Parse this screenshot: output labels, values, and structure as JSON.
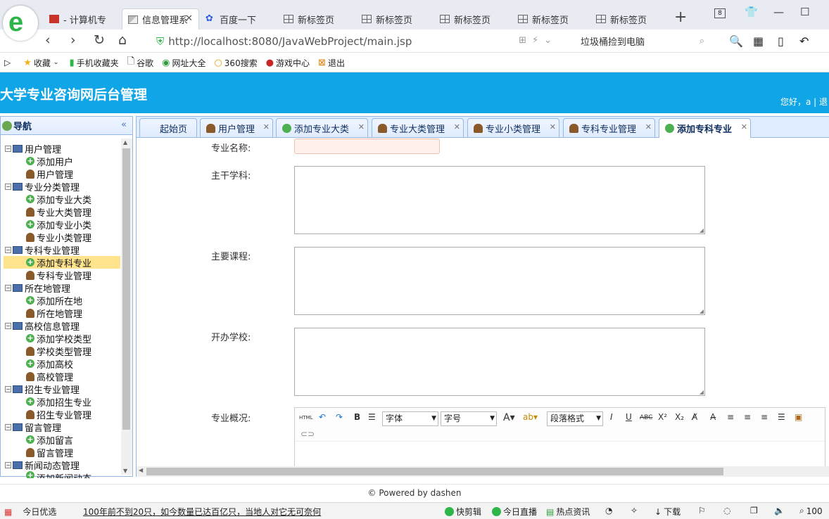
{
  "browser": {
    "tabs": [
      {
        "label": "- 计算机专",
        "icon": "red-square-icon",
        "active": false
      },
      {
        "label": "信息管理系",
        "icon": "image-icon",
        "active": true
      },
      {
        "label": "百度一下",
        "icon": "baidu-paw-icon",
        "active": false
      },
      {
        "label": "新标签页",
        "icon": "grid-icon",
        "active": false
      },
      {
        "label": "新标签页",
        "icon": "grid-icon",
        "active": false
      },
      {
        "label": "新标签页",
        "icon": "grid-icon",
        "active": false
      },
      {
        "label": "新标签页",
        "icon": "grid-icon",
        "active": false
      },
      {
        "label": "新标签页",
        "icon": "grid-icon",
        "active": false
      }
    ],
    "tab_count": "8",
    "url": "http://localhost:8080/JavaWebProject/main.jsp",
    "search_text": "垃圾桶捡到电脑",
    "bookmarks": [
      "收藏",
      "手机收藏夹",
      "谷歌",
      "网址大全",
      "360搜索",
      "游戏中心",
      "退出"
    ]
  },
  "app": {
    "title": "大学专业咨询网后台管理",
    "greeting": "您好，a | 退",
    "nav_title": "导航",
    "tree": [
      {
        "label": "用户管理",
        "children": [
          "添加用户",
          "用户管理"
        ]
      },
      {
        "label": "专业分类管理",
        "children": [
          "添加专业大类",
          "专业大类管理",
          "添加专业小类",
          "专业小类管理"
        ]
      },
      {
        "label": "专科专业管理",
        "children": [
          "添加专科专业",
          "专科专业管理"
        ]
      },
      {
        "label": "所在地管理",
        "children": [
          "添加所在地",
          "所在地管理"
        ]
      },
      {
        "label": "高校信息管理",
        "children": [
          "添加学校类型",
          "学校类型管理",
          "添加高校",
          "高校管理"
        ]
      },
      {
        "label": "招生专业管理",
        "children": [
          "添加招生专业",
          "招生专业管理"
        ]
      },
      {
        "label": "留言管理",
        "children": [
          "添加留言",
          "留言管理"
        ]
      },
      {
        "label": "新闻动态管理",
        "children": [
          "添加新闻动态"
        ]
      }
    ],
    "selected_node": "添加专科专业",
    "tabs": [
      {
        "label": "起始页",
        "icon": "none",
        "closable": false
      },
      {
        "label": "用户管理",
        "icon": "user-icon",
        "closable": true
      },
      {
        "label": "添加专业大类",
        "icon": "add-icon",
        "closable": true
      },
      {
        "label": "专业大类管理",
        "icon": "user-icon",
        "closable": true
      },
      {
        "label": "专业小类管理",
        "icon": "user-icon",
        "closable": true
      },
      {
        "label": "专科专业管理",
        "icon": "user-icon",
        "closable": true
      },
      {
        "label": "添加专科专业",
        "icon": "add-icon",
        "closable": true
      }
    ],
    "form": {
      "name_label": "专业名称:",
      "subject_label": "主干学科:",
      "courses_label": "主要课程:",
      "schools_label": "开办学校:",
      "overview_label": "专业概况:",
      "editor": {
        "html_btn": "HTML",
        "font_select": "字体",
        "size_select": "字号",
        "format_select": "段落格式"
      }
    },
    "footer": "© Powered by dashen"
  },
  "statusbar": {
    "left_label": "今日优选",
    "news": "100年前不到20只，如今数量已达百亿只，当地人对它无可奈何",
    "items": [
      "快剪辑",
      "今日直播",
      "热点资讯",
      "下载",
      "100"
    ]
  }
}
